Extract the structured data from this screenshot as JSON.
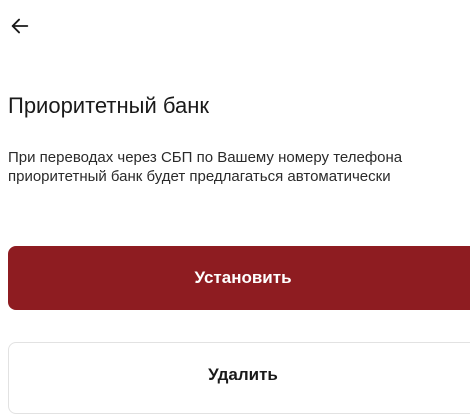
{
  "header": {
    "back_icon": "arrow-left-icon"
  },
  "main": {
    "title": "Приоритетный банк",
    "description": "При переводах через СБП по Вашему номеру телефона приоритетный банк будет предлагаться автоматически",
    "set_button_label": "Установить",
    "delete_button_label": "Удалить"
  },
  "colors": {
    "primary": "#8e1c21",
    "background": "#ffffff",
    "text": "#1a1a1a"
  }
}
